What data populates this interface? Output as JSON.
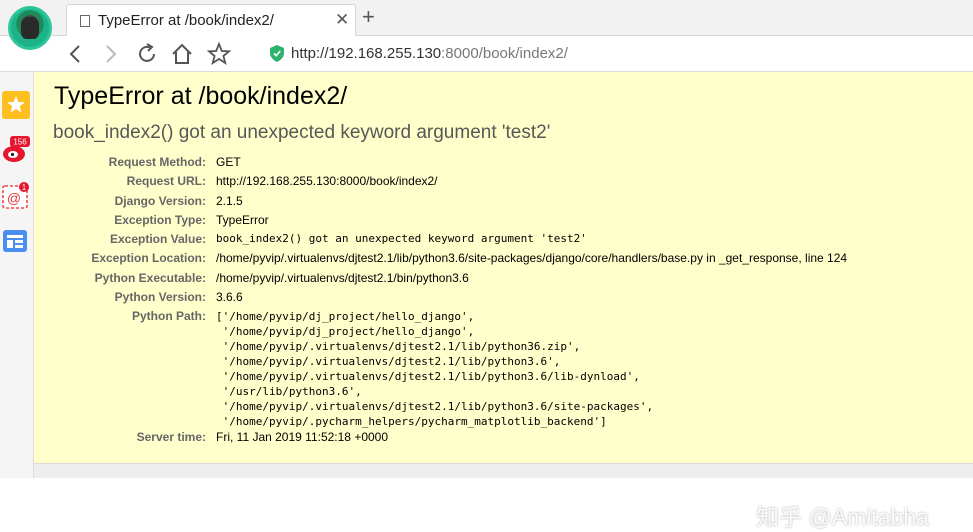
{
  "browser": {
    "tab_title": "TypeError at /book/index2/",
    "tab_close": "✕",
    "new_tab": "+",
    "url_main": "http://192.168.255.130",
    "url_port": ":8000",
    "url_path": "/book/index2/",
    "sidebar_badges": {
      "weibo": "156",
      "mail": "1"
    }
  },
  "page": {
    "title": "TypeError at /book/index2/",
    "subtitle": "book_index2() got an unexpected keyword argument 'test2'",
    "meta": [
      {
        "label": "Request Method:",
        "value": "GET"
      },
      {
        "label": "Request URL:",
        "value": "http://192.168.255.130:8000/book/index2/"
      },
      {
        "label": "Django Version:",
        "value": "2.1.5"
      },
      {
        "label": "Exception Type:",
        "value": "TypeError"
      },
      {
        "label": "Exception Value:",
        "value": "book_index2() got an unexpected keyword argument 'test2'"
      },
      {
        "label": "Exception Location:",
        "value": "/home/pyvip/.virtualenvs/djtest2.1/lib/python3.6/site-packages/django/core/handlers/base.py in _get_response, line 124"
      },
      {
        "label": "Python Executable:",
        "value": "/home/pyvip/.virtualenvs/djtest2.1/bin/python3.6"
      },
      {
        "label": "Python Version:",
        "value": "3.6.6"
      }
    ],
    "python_path_label": "Python Path:",
    "python_path": [
      "['/home/pyvip/dj_project/hello_django',",
      " '/home/pyvip/dj_project/hello_django',",
      " '/home/pyvip/.virtualenvs/djtest2.1/lib/python36.zip',",
      " '/home/pyvip/.virtualenvs/djtest2.1/lib/python3.6',",
      " '/home/pyvip/.virtualenvs/djtest2.1/lib/python3.6/lib-dynload',",
      " '/usr/lib/python3.6',",
      " '/home/pyvip/.virtualenvs/djtest2.1/lib/python3.6/site-packages',",
      " '/home/pyvip/.pycharm_helpers/pycharm_matplotlib_backend']"
    ],
    "server_time_label": "Server time:",
    "server_time": "Fri, 11 Jan 2019 11:52:18 +0000"
  },
  "watermark": "知乎 @Amitabha"
}
